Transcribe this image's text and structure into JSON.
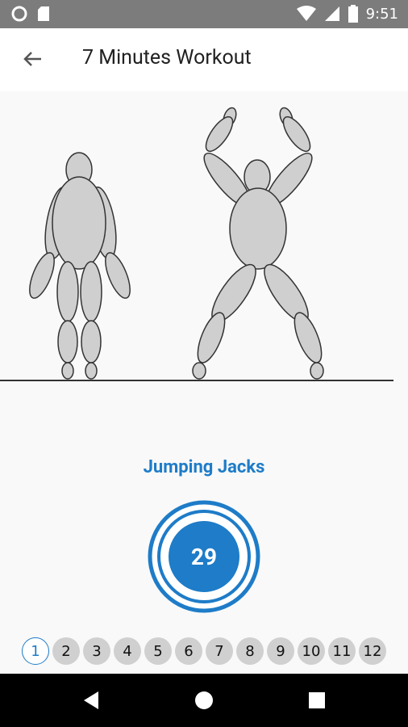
{
  "status_bar": {
    "time": "9:51",
    "icons": [
      "record-icon",
      "sd-card-icon",
      "wifi-icon",
      "cell-signal-icon",
      "battery-icon"
    ]
  },
  "app_bar": {
    "title": "7 Minutes Workout",
    "back_icon": "arrow-back-icon"
  },
  "exercise": {
    "name": "Jumping Jacks",
    "seconds_remaining": "29"
  },
  "steps": [
    {
      "label": "1",
      "active": true
    },
    {
      "label": "2",
      "active": false
    },
    {
      "label": "3",
      "active": false
    },
    {
      "label": "4",
      "active": false
    },
    {
      "label": "5",
      "active": false
    },
    {
      "label": "6",
      "active": false
    },
    {
      "label": "7",
      "active": false
    },
    {
      "label": "8",
      "active": false
    },
    {
      "label": "9",
      "active": false
    },
    {
      "label": "10",
      "active": false
    },
    {
      "label": "11",
      "active": false
    },
    {
      "label": "12",
      "active": false
    }
  ],
  "nav_bar": {
    "icons": [
      "back-triangle-icon",
      "home-circle-icon",
      "recents-square-icon"
    ]
  },
  "colors": {
    "accent": "#1e7cc8",
    "status_bar": "#7c7c7c",
    "figure_fill": "#cfcfcf"
  }
}
